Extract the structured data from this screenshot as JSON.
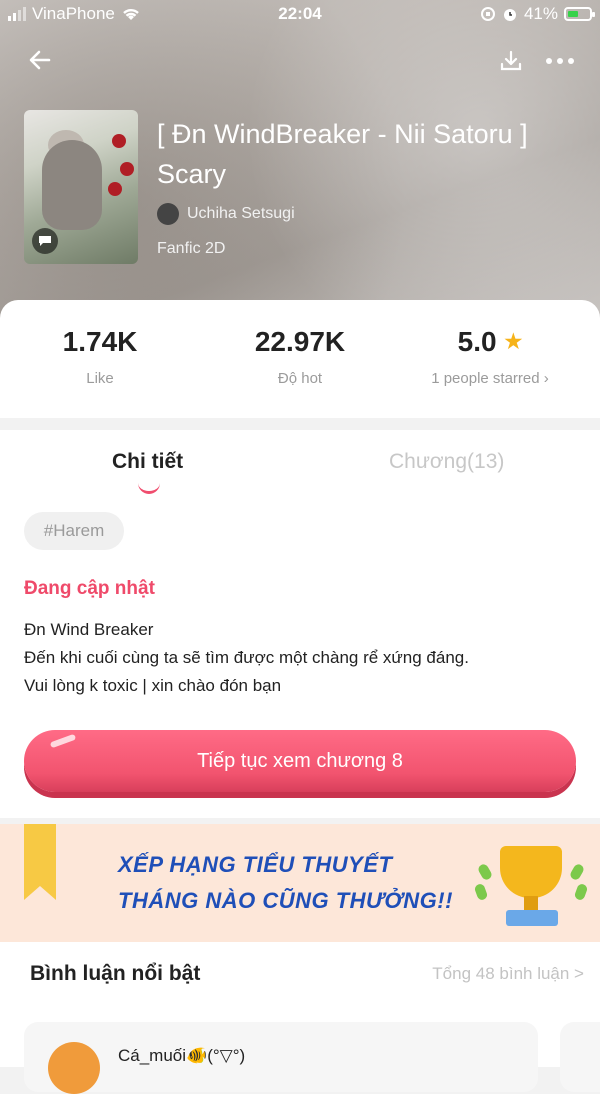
{
  "status_bar": {
    "carrier": "VinaPhone",
    "time": "22:04",
    "battery": "41%"
  },
  "book": {
    "title": "[ Đn WindBreaker - Nii Satoru ] Scary",
    "author": "Uchiha Setsugi",
    "category": "Fanfic 2D"
  },
  "stats": {
    "likes_value": "1.74K",
    "likes_label": "Like",
    "hot_value": "22.97K",
    "hot_label": "Độ hot",
    "rating_value": "5.0",
    "rating_label": "1 people starred",
    "rating_chevron": "›"
  },
  "tabs": {
    "details": "Chi tiết",
    "chapters": "Chương(13)"
  },
  "tag": "#Harem",
  "update_status": "Đang cập nhật",
  "description": [
    "Đn Wind Breaker",
    "Đến khi cuối cùng ta sẽ tìm được một chàng rể xứng đáng.",
    "Vui lòng k toxic | xin chào đón bạn"
  ],
  "cta": "Tiếp tục xem chương 8",
  "banner": {
    "line1": "XẾP HẠNG TIỂU THUYẾT",
    "line2": "THÁNG NÀO CŨNG THƯỞNG!!"
  },
  "comments": {
    "header": "Bình luận nổi bật",
    "total": "Tổng 48 bình luận >",
    "first_user": "Cá_muối🐠(°▽°)"
  },
  "icons": {
    "back": "arrow-left",
    "download": "download",
    "more": "ellipsis",
    "star": "★"
  },
  "colors": {
    "accent": "#f2546f",
    "star": "#f6b319",
    "banner_text": "#1f4fb8"
  }
}
